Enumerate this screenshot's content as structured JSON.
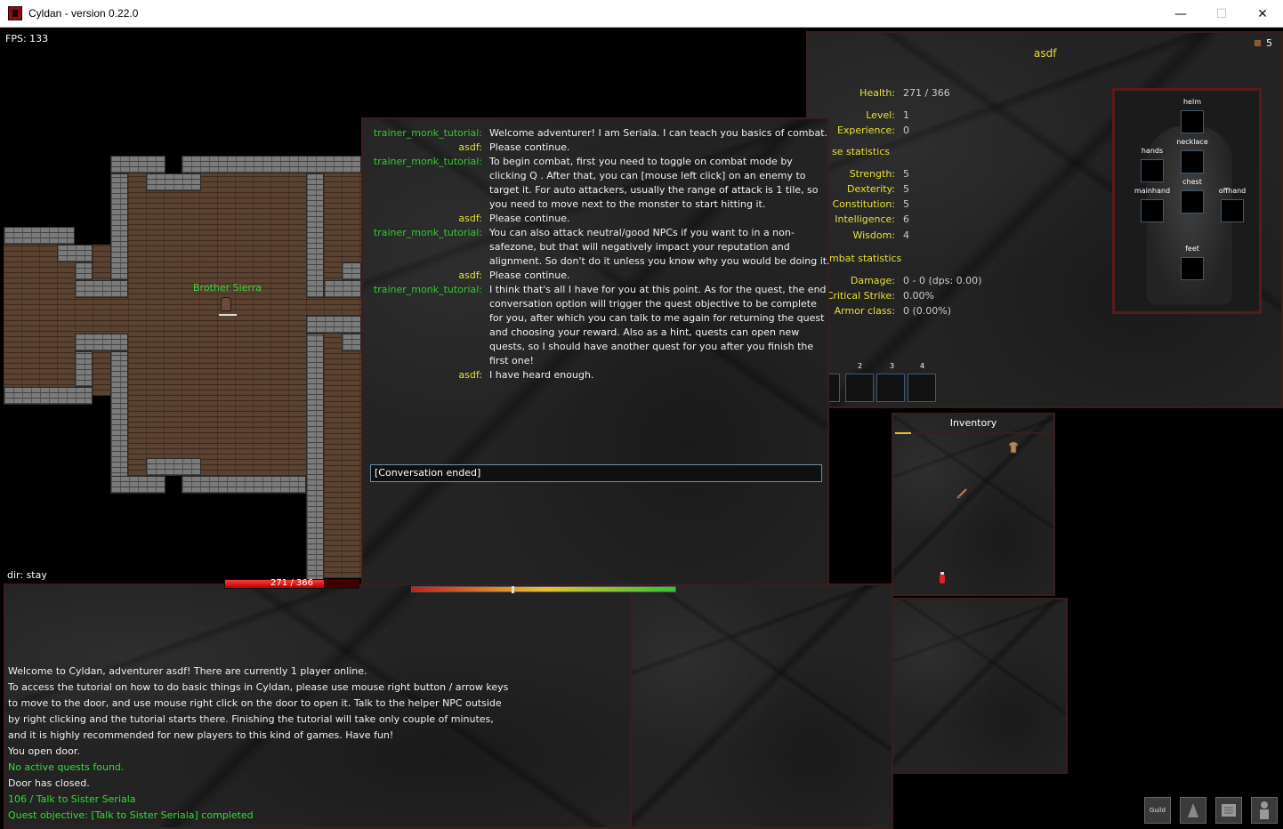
{
  "window": {
    "title": "Cyldan - version 0.22.0",
    "minimize_glyph": "—",
    "maximize_glyph": "☐",
    "close_glyph": "✕"
  },
  "game_view": {
    "fps_text": "FPS: 133",
    "dir_text": "dir: stay",
    "npc_name": "Brother Sierra"
  },
  "dialogue": {
    "lines": [
      {
        "speaker": "trainer_monk_tutorial:",
        "role": "npc",
        "text": "Welcome adventurer! I am Seriala. I can teach you basics of combat."
      },
      {
        "speaker": "asdf:",
        "role": "player",
        "text": "Please continue."
      },
      {
        "speaker": "trainer_monk_tutorial:",
        "role": "npc",
        "text": "To begin combat, first you need to toggle on combat mode by clicking Q . After that, you can [mouse left click] on an enemy to target it. For auto attackers, usually the range of attack is 1 tile, so you need to move next to the monster to start hitting it."
      },
      {
        "speaker": "asdf:",
        "role": "player",
        "text": "Please continue."
      },
      {
        "speaker": "trainer_monk_tutorial:",
        "role": "npc",
        "text": "You can also attack neutral/good NPCs if you want to in a non-safezone, but that will negatively impact your reputation and alignment. So don't do it unless you know why you would be doing it."
      },
      {
        "speaker": "asdf:",
        "role": "player",
        "text": "Please continue."
      },
      {
        "speaker": "trainer_monk_tutorial:",
        "role": "npc",
        "text": "I think that's all I have for you at this point. As for the quest, the end conversation option will trigger the quest objective to be complete for you, after which you can talk to me again for returning the quest and choosing your reward. Also as a hint, quests can open new quests, so I should have another quest for you after you finish the first one!"
      },
      {
        "speaker": "asdf:",
        "role": "player",
        "text": "I have heard enough."
      }
    ],
    "input_text": "[Conversation ended]"
  },
  "character": {
    "name": "asdf",
    "gold": "5",
    "health_label": "Health:",
    "health_value": "271 / 366",
    "level_label": "Level:",
    "level_value": "1",
    "experience_label": "Experience:",
    "experience_value": "0",
    "base_stats_heading": "se statistics",
    "strength_label": "Strength:",
    "strength_value": "5",
    "dexterity_label": "Dexterity:",
    "dexterity_value": "5",
    "constitution_label": "Constitution:",
    "constitution_value": "5",
    "intelligence_label": "Intelligence:",
    "intelligence_value": "6",
    "wisdom_label": "Wisdom:",
    "wisdom_value": "4",
    "combat_stats_heading": "mbat statistics",
    "damage_label": "Damage:",
    "damage_value": "0 - 0 (dps: 0.00)",
    "crit_label": "Critical Strike:",
    "crit_value": "0.00%",
    "armor_label": "Armor class:",
    "armor_value": "0 (0.00%)",
    "equip_slots": {
      "helm": "helm",
      "necklace": "necklace",
      "hands": "hands",
      "chest": "chest",
      "mainhand": "mainhand",
      "offhand": "offhand",
      "feet": "feet"
    },
    "hotbar_numbers": [
      "2",
      "3",
      "4"
    ]
  },
  "inventory": {
    "title": "Inventory",
    "items": [
      "shirt-icon",
      "dagger-icon",
      "potion-icon"
    ]
  },
  "chatlog": {
    "lines": [
      {
        "text": "Welcome to Cyldan, adventurer asdf! There are currently 1 player online.",
        "color": "white"
      },
      {
        "text": "To access the tutorial on how to do basic things in Cyldan, please use mouse right button / arrow keys",
        "color": "white"
      },
      {
        "text": "to move to the door, and use mouse right click on the door to open it. Talk to the helper NPC outside",
        "color": "white"
      },
      {
        "text": "by right clicking and the tutorial starts there. Finishing the tutorial will take only couple of minutes,",
        "color": "white"
      },
      {
        "text": "and it is highly recommended for new players to this kind of games. Have fun!",
        "color": "white"
      },
      {
        "text": "You open door.",
        "color": "white"
      },
      {
        "text": "No active quests found.",
        "color": "green"
      },
      {
        "text": "Door has closed.",
        "color": "white"
      },
      {
        "text": "106 / Talk to Sister Seriala",
        "color": "green"
      },
      {
        "text": "Quest objective: [Talk to Sister Seriala] completed",
        "color": "green"
      }
    ]
  },
  "bars": {
    "hp_text": "271 / 366",
    "hp_fraction": 0.74,
    "xp_marker_fraction": 0.38
  },
  "menu": {
    "guild_label": "Guild",
    "buttons": [
      "guild-icon",
      "skills-icon",
      "quest-scroll-icon",
      "character-icon"
    ]
  },
  "colors": {
    "npc_speaker": "#32c832",
    "player_speaker": "#e8e030",
    "stat_label": "#e8e030",
    "chat_green": "#32dc32",
    "panel_border": "#3a1e1e"
  }
}
